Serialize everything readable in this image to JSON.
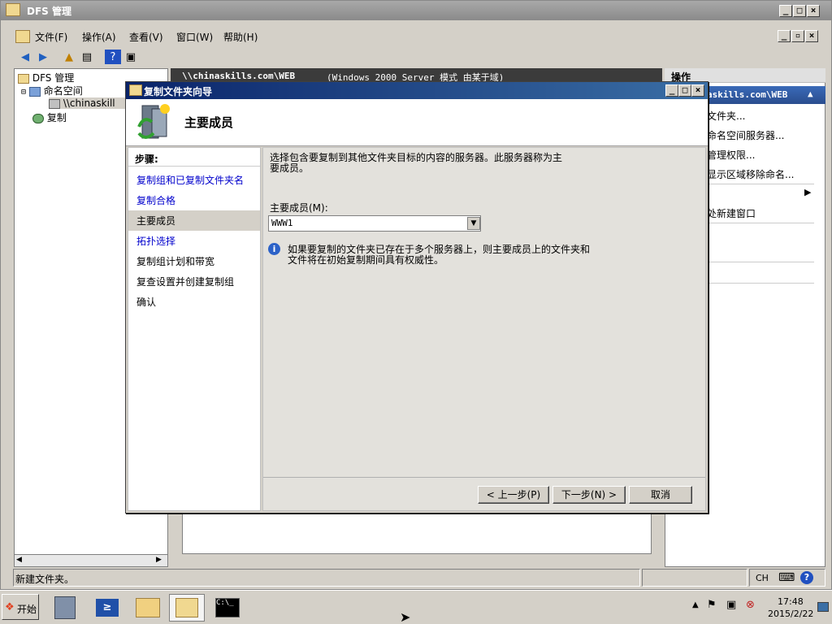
{
  "window": {
    "title": "DFS 管理"
  },
  "menu": [
    "文件(F)",
    "操作(A)",
    "查看(V)",
    "窗口(W)",
    "帮助(H)"
  ],
  "tree": {
    "root": "DFS 管理",
    "namespace": "命名空间",
    "namespace_child": "\\\\chinaskill",
    "replication": "复制"
  },
  "center": {
    "path": "\\\\chinaskills.com\\WEB",
    "mode": "(Windows 2000 Server 模式 由某于域)"
  },
  "actions": {
    "header": "操作",
    "sub": "askills.com\\WEB",
    "items": [
      "文件夹...",
      "命名空间服务器...",
      "管理权限...",
      "显示区域移除命名...",
      "",
      "处新建窗口",
      "",
      "",
      "",
      ""
    ]
  },
  "status": {
    "text": "新建文件夹。"
  },
  "wizard": {
    "title": "复制文件夹向导",
    "heading": "主要成员",
    "steps_label": "步骤:",
    "steps": [
      "复制组和已复制文件夹名",
      "复制合格",
      "主要成员",
      "拓扑选择",
      "复制组计划和带宽",
      "复查设置并创建复制组",
      "确认"
    ],
    "description_line1": "选择包含要复制到其他文件夹目标的内容的服务器。此服务器称为主",
    "description_line2": "要成员。",
    "field_label": "主要成员(M):",
    "field_value": "WWW1",
    "info_line1": "如果要复制的文件夹已存在于多个服务器上，则主要成员上的文件夹和",
    "info_line2": "文件将在初始复制期间具有权威性。",
    "btn_back": "< 上一步(P)",
    "btn_next": "下一步(N) >",
    "btn_cancel": "取消"
  },
  "taskbar": {
    "start": "开始",
    "lang": "CH",
    "time": "17:48",
    "date": "2015/2/22"
  }
}
